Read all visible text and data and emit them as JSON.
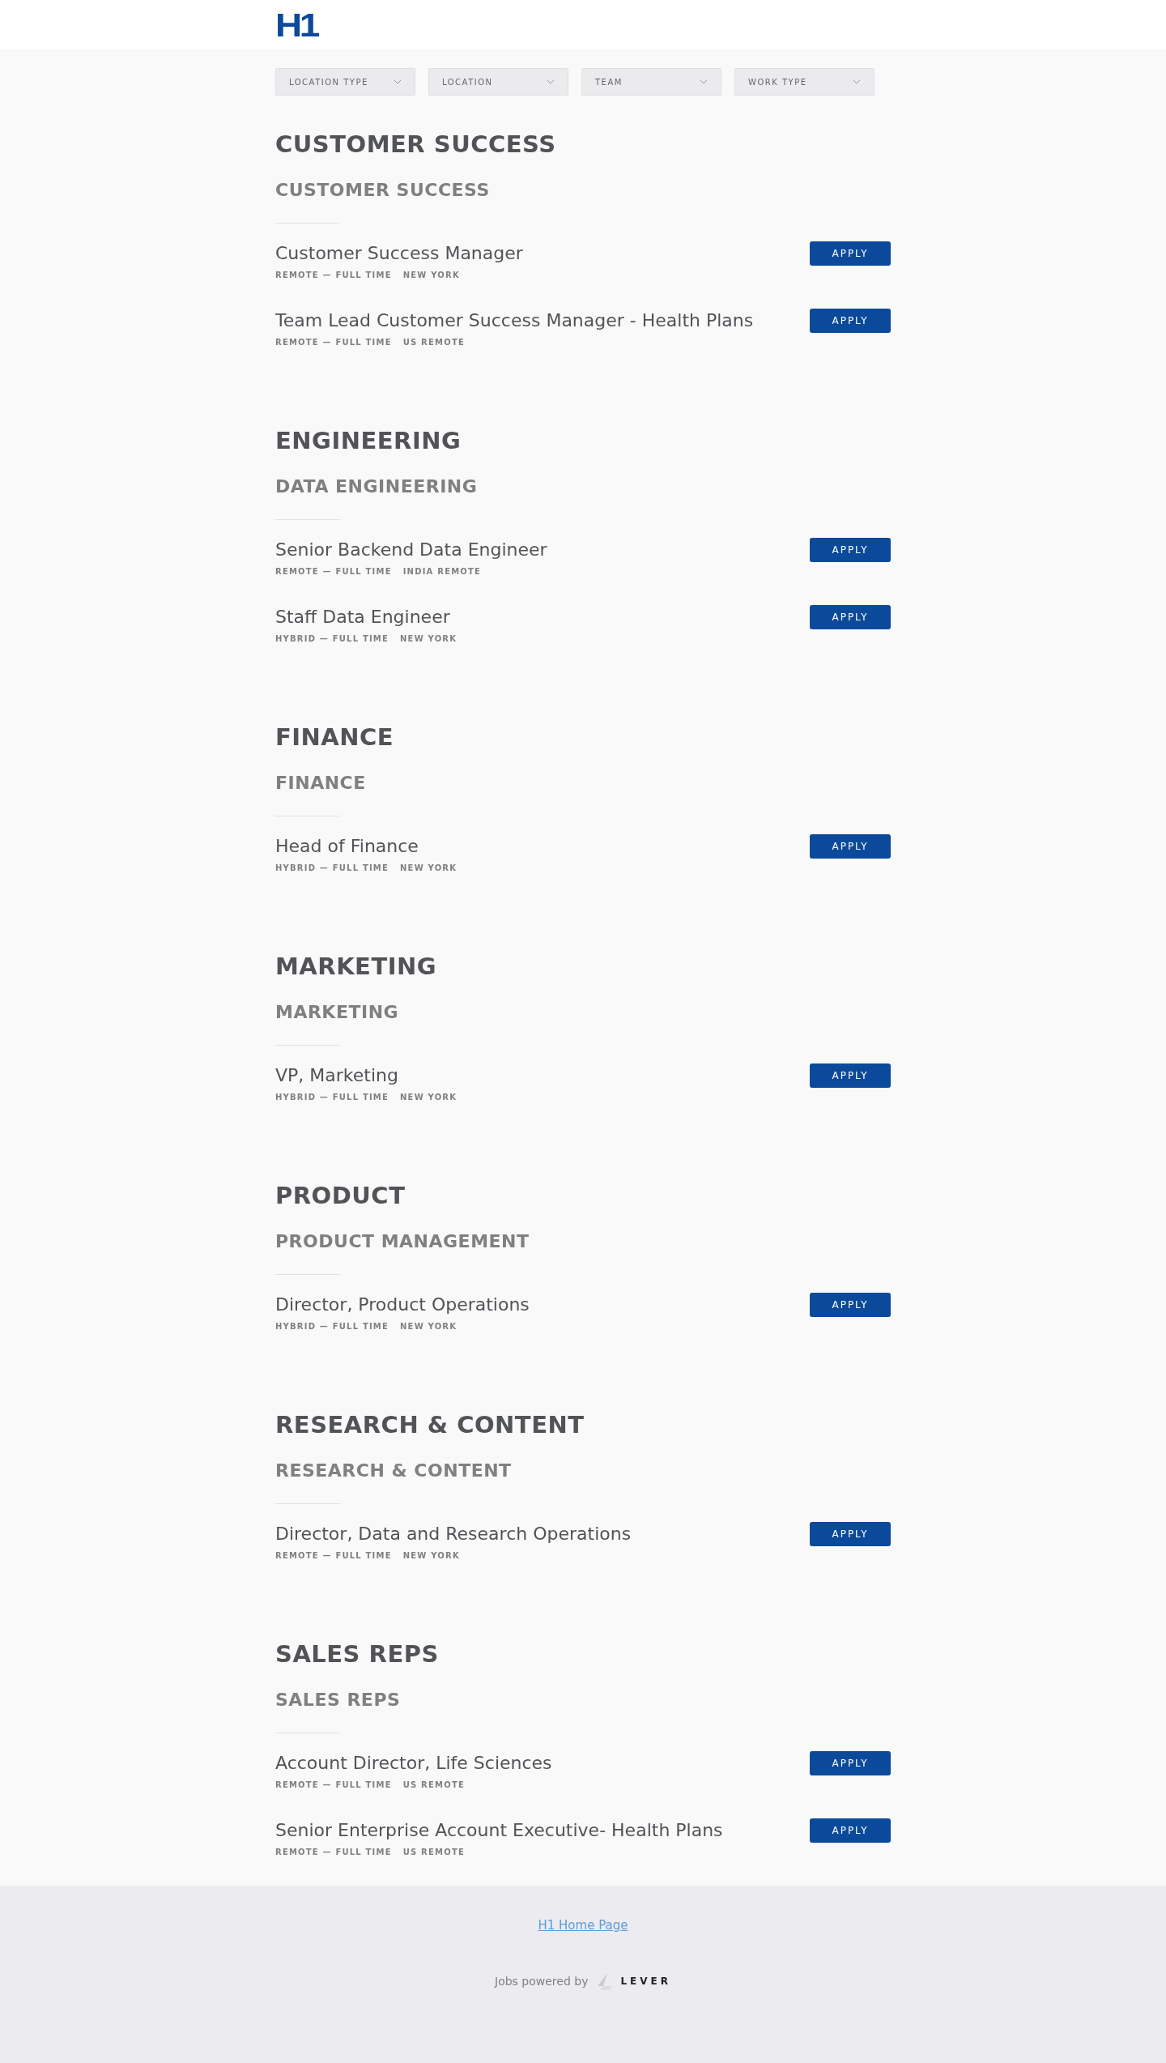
{
  "header": {
    "logo": "H1"
  },
  "filters": [
    {
      "label": "LOCATION TYPE"
    },
    {
      "label": "LOCATION"
    },
    {
      "label": "TEAM"
    },
    {
      "label": "WORK TYPE"
    }
  ],
  "departments": [
    {
      "title": "CUSTOMER SUCCESS",
      "team": "CUSTOMER SUCCESS",
      "postings": [
        {
          "title": "Customer Success Manager",
          "workplace": "REMOTE — FULL TIME",
          "location": "NEW YORK",
          "button": "APPLY"
        },
        {
          "title": "Team Lead Customer Success Manager - Health Plans",
          "workplace": "REMOTE — FULL TIME",
          "location": "US REMOTE",
          "button": "APPLY"
        }
      ]
    },
    {
      "title": "ENGINEERING",
      "team": "DATA ENGINEERING",
      "postings": [
        {
          "title": "Senior Backend Data Engineer",
          "workplace": "REMOTE — FULL TIME",
          "location": "INDIA REMOTE",
          "button": "APPLY"
        },
        {
          "title": "Staff Data Engineer",
          "workplace": "HYBRID — FULL TIME",
          "location": "NEW YORK",
          "button": "APPLY"
        }
      ]
    },
    {
      "title": "FINANCE",
      "team": "FINANCE",
      "postings": [
        {
          "title": "Head of Finance",
          "workplace": "HYBRID — FULL TIME",
          "location": "NEW YORK",
          "button": "APPLY"
        }
      ]
    },
    {
      "title": "MARKETING",
      "team": "MARKETING",
      "postings": [
        {
          "title": "VP, Marketing",
          "workplace": "HYBRID — FULL TIME",
          "location": "NEW YORK",
          "button": "APPLY"
        }
      ]
    },
    {
      "title": "PRODUCT",
      "team": "PRODUCT MANAGEMENT",
      "postings": [
        {
          "title": "Director, Product Operations",
          "workplace": "HYBRID — FULL TIME",
          "location": "NEW YORK",
          "button": "APPLY"
        }
      ]
    },
    {
      "title": "RESEARCH & CONTENT",
      "team": "RESEARCH & CONTENT",
      "postings": [
        {
          "title": "Director, Data and Research Operations",
          "workplace": "REMOTE — FULL TIME",
          "location": "NEW YORK",
          "button": "APPLY"
        }
      ]
    },
    {
      "title": "SALES REPS",
      "team": "SALES REPS",
      "postings": [
        {
          "title": "Account Director, Life Sciences",
          "workplace": "REMOTE — FULL TIME",
          "location": "US REMOTE",
          "button": "APPLY"
        },
        {
          "title": "Senior Enterprise Account Executive- Health Plans",
          "workplace": "REMOTE — FULL TIME",
          "location": "US REMOTE",
          "button": "APPLY"
        }
      ]
    }
  ],
  "footer": {
    "link": "H1 Home Page",
    "powered_by": "Jobs powered by",
    "brand": "LEVER"
  }
}
